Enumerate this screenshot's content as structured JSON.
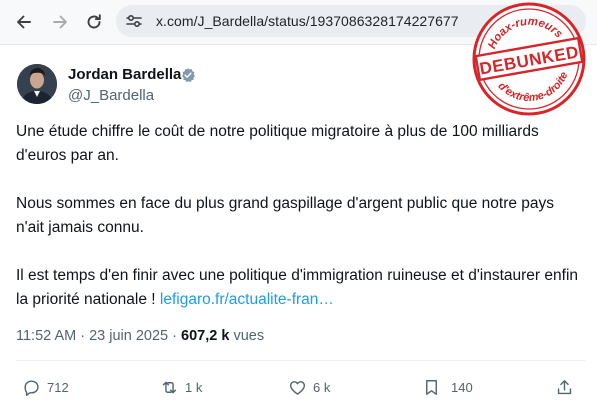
{
  "browser": {
    "url": "x.com/J_Bardella/status/1937086328174227677",
    "back_icon": "arrow-left-icon",
    "forward_icon": "arrow-right-icon",
    "reload_icon": "reload-icon",
    "site_settings_icon": "tune-icon"
  },
  "stamp": {
    "top_text": "Hoax-rumeurs",
    "center_text": "DEBUNKED",
    "bottom_text": "d'extrême-droite",
    "color": "#d6262a"
  },
  "tweet": {
    "author_name": "Jordan Bardella",
    "handle": "@J_Bardella",
    "paragraphs": [
      "Une étude chiffre le coût de notre politique migratoire à plus de 100 milliards d'euros par an.",
      "Nous sommes en face du plus grand gaspillage d'argent public que notre pays n'ait jamais connu."
    ],
    "last_paragraph_text": "Il est temps d'en finir avec une politique d'immigration ruineuse et d'instaurer enfin la priorité nationale ! ",
    "link_text": "lefigaro.fr/actualite-fran…",
    "time": "11:52 AM",
    "separator": "·",
    "date": "23 juin 2025",
    "views_count": "607,2 k",
    "views_label": "vues"
  },
  "actions": {
    "replies": "712",
    "reposts": "1 k",
    "likes": "6 k",
    "bookmarks": "140"
  },
  "colors": {
    "link": "#1d9bf0",
    "verified": "#829aab",
    "muted_text": "#536471",
    "stamp_red": "#d6262a"
  }
}
